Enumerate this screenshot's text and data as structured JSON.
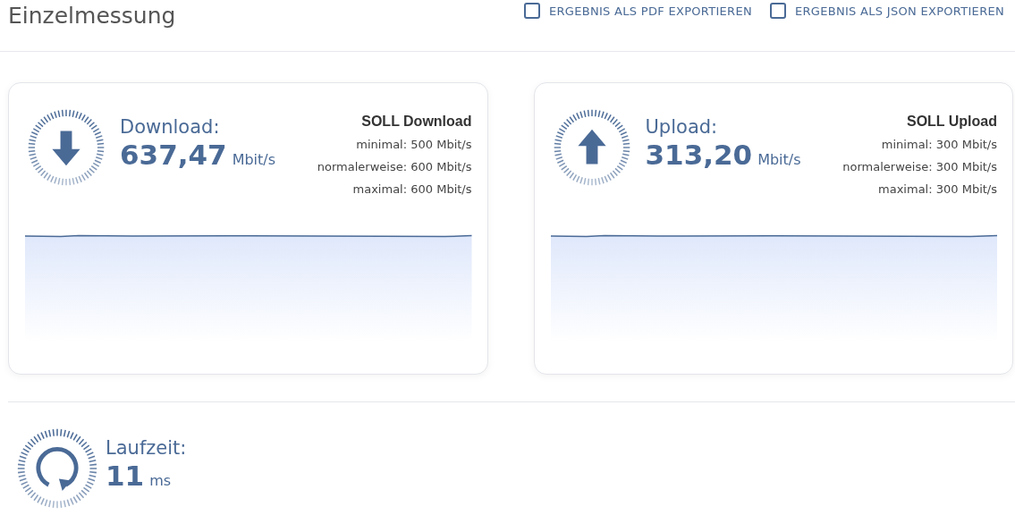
{
  "header": {
    "title": "Einzelmessung",
    "actions": [
      {
        "label": "ERGEBNIS ALS PDF EXPORTIEREN"
      },
      {
        "label": "ERGEBNIS ALS JSON EXPORTIEREN"
      }
    ]
  },
  "cards": [
    {
      "kind": "download",
      "label": "Download:",
      "value": "637,47",
      "unit": "Mbit/s",
      "target_title": "SOLL Download",
      "targets": [
        "minimal: 500 Mbit/s",
        "normalerweise: 600 Mbit/s",
        "maximal: 600 Mbit/s"
      ]
    },
    {
      "kind": "upload",
      "label": "Upload:",
      "value": "313,20",
      "unit": "Mbit/s",
      "target_title": "SOLL Upload",
      "targets": [
        "minimal: 300 Mbit/s",
        "normalerweise: 300 Mbit/s",
        "maximal: 300 Mbit/s"
      ]
    }
  ],
  "latency": {
    "label": "Laufzeit:",
    "value": "11",
    "unit": "ms"
  }
}
